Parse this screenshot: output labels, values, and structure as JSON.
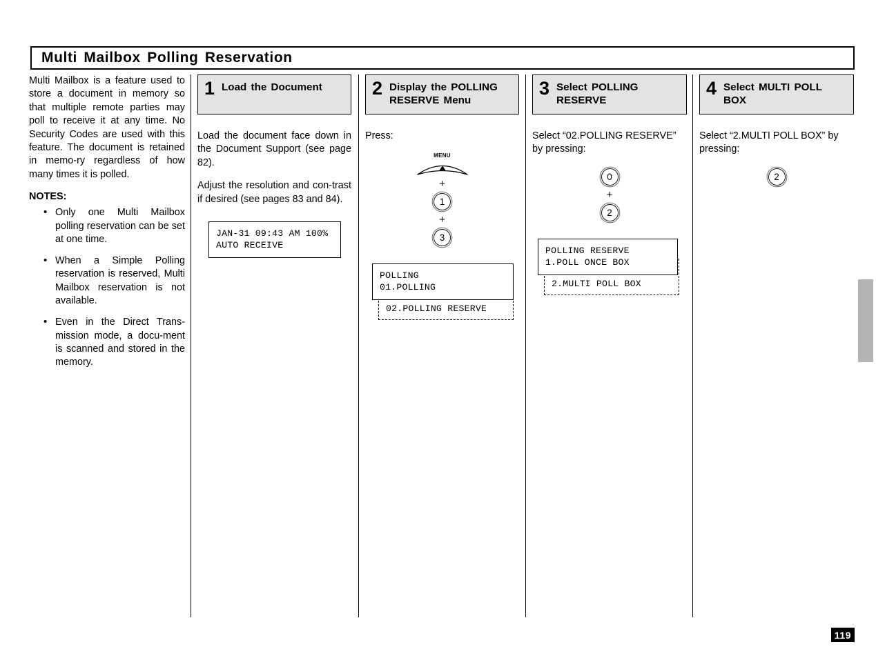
{
  "page": {
    "title": "Multi Mailbox Polling Reservation",
    "page_number": "119"
  },
  "intro": {
    "paragraph": "Multi Mailbox is a feature used to store a document in memory so that multiple remote parties may poll to receive it at any time. No Security Codes are used with this feature. The document is retained in memo-ry regardless of how many times it is polled.",
    "notes_heading": "NOTES:",
    "bullet": "•",
    "notes": [
      "Only one Multi Mailbox polling reservation can be set at one time.",
      "When a Simple Polling reservation is reserved, Multi Mailbox reservation is not available.",
      "Even in the Direct Trans-mission mode, a docu-ment is scanned and stored in the memory."
    ]
  },
  "steps": [
    {
      "number": "1",
      "label": "Load the Document",
      "paragraphs": [
        "Load the document face down in the Document Support (see page 82).",
        "Adjust the resolution and con-trast if desired (see pages 83 and 84)."
      ],
      "keys": [],
      "lcd": {
        "line1": "JAN-31 09:43 AM 100%",
        "line2": "AUTO RECEIVE",
        "ghost": null
      }
    },
    {
      "number": "2",
      "label": "Display the POLLING  RESERVE Menu",
      "paragraphs": [
        "Press:"
      ],
      "keys": [
        {
          "type": "menu",
          "label": "MENU"
        },
        {
          "type": "plus",
          "label": "+"
        },
        {
          "type": "key",
          "label": "1"
        },
        {
          "type": "plus",
          "label": "+"
        },
        {
          "type": "key",
          "label": "3"
        }
      ],
      "lcd": {
        "line1": "POLLING",
        "line2": "01.POLLING",
        "ghost": "02.POLLING RESERVE"
      }
    },
    {
      "number": "3",
      "label": "Select POLLING RESERVE",
      "paragraphs": [
        "Select “02.POLLING  RESERVE” by  pressing:"
      ],
      "keys": [
        {
          "type": "key",
          "label": "0"
        },
        {
          "type": "plus",
          "label": "+"
        },
        {
          "type": "key",
          "label": "2"
        }
      ],
      "lcd": {
        "line1": "POLLING RESERVE",
        "line2": "1.POLL ONCE BOX",
        "ghost": "2.MULTI POLL BOX"
      }
    },
    {
      "number": "4",
      "label": "Select MULTI POLL BOX",
      "paragraphs": [
        "Select “2.MULTI POLL BOX” by  pressing:"
      ],
      "keys": [
        {
          "type": "key",
          "label": "2"
        }
      ],
      "lcd": null
    }
  ],
  "colors": {
    "step_header_bg": "#e3e3e3",
    "side_tab": "#b3b3b3",
    "badge_bg": "#000000",
    "text": "#000000"
  }
}
